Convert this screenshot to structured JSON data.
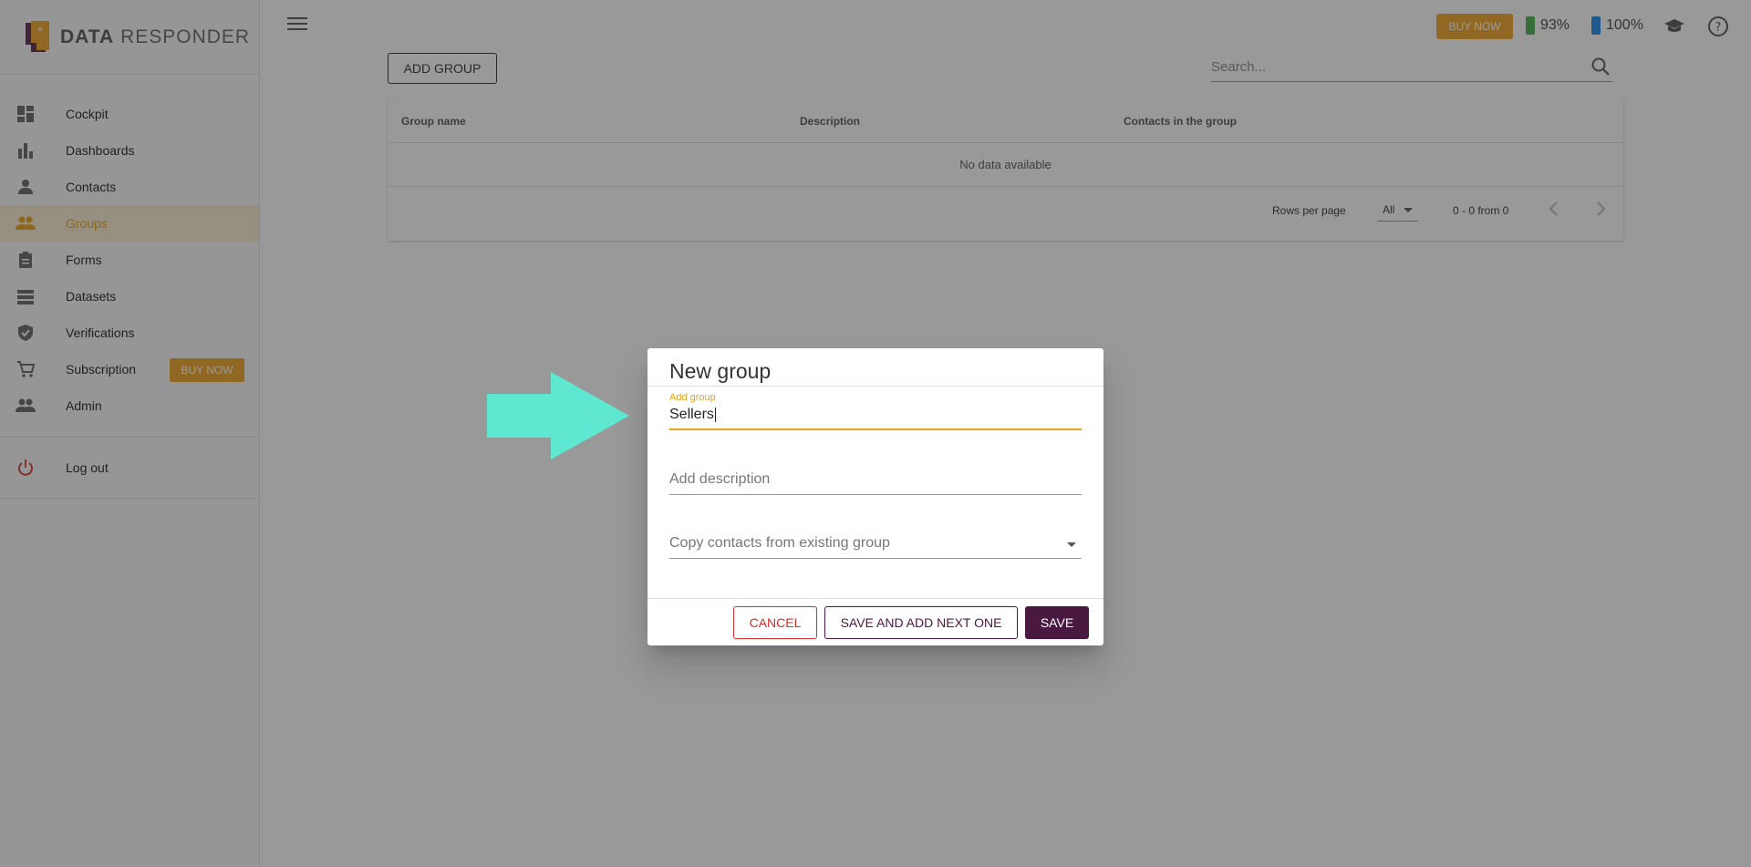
{
  "app": {
    "logo_text_bold": "DATA",
    "logo_text": "RESPONDER"
  },
  "sidebar": {
    "items": [
      {
        "label": "Cockpit",
        "icon": "dashboard-icon"
      },
      {
        "label": "Dashboards",
        "icon": "bar-chart-icon"
      },
      {
        "label": "Contacts",
        "icon": "person-icon"
      },
      {
        "label": "Groups",
        "icon": "people-icon",
        "active": true
      },
      {
        "label": "Forms",
        "icon": "clipboard-icon"
      },
      {
        "label": "Datasets",
        "icon": "list-icon"
      },
      {
        "label": "Verifications",
        "icon": "shield-icon"
      },
      {
        "label": "Subscription",
        "icon": "cart-icon"
      },
      {
        "label": "Admin",
        "icon": "people-icon"
      }
    ],
    "buy_now": "BUY NOW",
    "logout": "Log out"
  },
  "topbar": {
    "buy_now": "BUY NOW",
    "battery_green": "93%",
    "battery_blue": "100%"
  },
  "main": {
    "add_group": "ADD GROUP",
    "search_placeholder": "Search...",
    "table": {
      "columns": [
        "Group name",
        "Description",
        "Contacts in the group"
      ],
      "empty": "No data available",
      "rows_per_page_label": "Rows per page",
      "rows_per_page_value": "All",
      "range": "0 - 0 from 0"
    }
  },
  "dialog": {
    "title": "New group",
    "group_label": "Add group",
    "group_value": "Sellers",
    "description_placeholder": "Add description",
    "copy_placeholder": "Copy contacts from existing group",
    "cancel": "CANCEL",
    "save_next": "SAVE AND ADD NEXT ONE",
    "save": "SAVE"
  },
  "colors": {
    "accent": "#e9a31a",
    "primary": "#4a1942",
    "danger": "#d32f2f",
    "arrow": "#5ee8d2"
  }
}
